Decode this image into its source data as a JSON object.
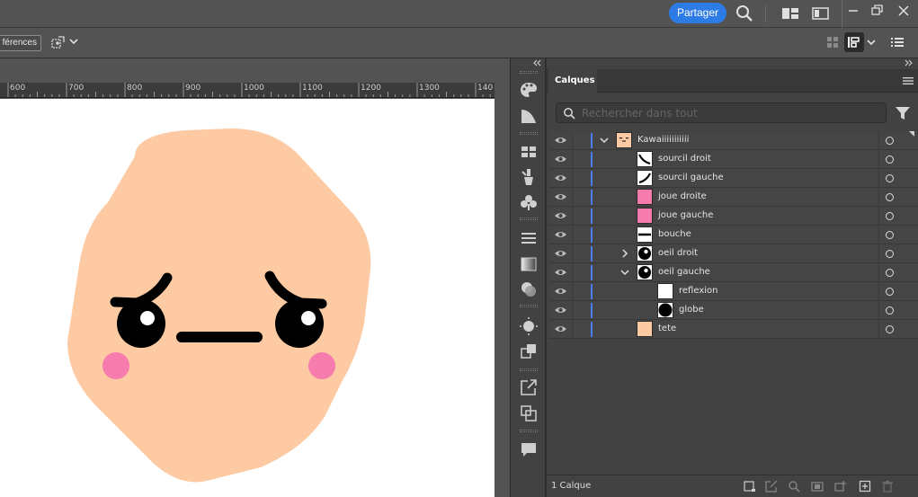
{
  "appbar": {
    "share_label": "Partager",
    "icons": [
      "search-icon",
      "arrange-documents-icon",
      "workspace-icon",
      "minimize-icon",
      "restore-icon",
      "close-icon"
    ]
  },
  "controlbar": {
    "preferences_label": "férences",
    "icons": [
      "transform-again-icon",
      "chevron-down-icon",
      "grid-icon",
      "align-panel-icon",
      "chevron-down-icon",
      "list-icon"
    ]
  },
  "ruler": {
    "ticks": [
      "600",
      "700",
      "800",
      "900",
      "1000",
      "1100",
      "1200",
      "1300",
      "140"
    ]
  },
  "strip": {
    "icons": [
      "color-icon",
      "color-guide-icon",
      "swatches-icon",
      "brushes-icon",
      "symbols-icon",
      "stroke-icon",
      "gradient-icon",
      "transparency-icon",
      "appearance-icon",
      "graphic-styles-icon",
      "export-icon",
      "artboards-icon",
      "comments-icon"
    ]
  },
  "layers_panel": {
    "tab_label": "Calques",
    "search_placeholder": "Rechercher dans tout",
    "footer_count": "1 Calque",
    "footer_icons": [
      "collect-export-icon",
      "export-selection-icon",
      "locate-object-icon",
      "make-clipping-mask-icon",
      "new-sublayer-icon",
      "new-layer-icon",
      "delete-icon"
    ],
    "layers": [
      {
        "name": "Kawaiiiiiiiiiii",
        "toggle": "open",
        "thumb": "face"
      },
      {
        "name": "sourcil droit",
        "toggle": "",
        "thumb": "brow-right"
      },
      {
        "name": "sourcil gauche",
        "toggle": "",
        "thumb": "brow-left"
      },
      {
        "name": "joue droite",
        "toggle": "",
        "thumb": "cheek"
      },
      {
        "name": "joue gauche",
        "toggle": "",
        "thumb": "cheek"
      },
      {
        "name": "bouche",
        "toggle": "",
        "thumb": "mouth"
      },
      {
        "name": "oeil droit",
        "toggle": "closed",
        "thumb": "eye"
      },
      {
        "name": "oeil gauche",
        "toggle": "open",
        "thumb": "eye"
      },
      {
        "name": "reflexion",
        "toggle": "",
        "thumb": "blank"
      },
      {
        "name": "globe",
        "toggle": "",
        "thumb": "globe"
      },
      {
        "name": "tete",
        "toggle": "",
        "thumb": "head"
      }
    ]
  },
  "colors": {
    "accent": "#2d7be5",
    "layer_bar": "#4a7df0",
    "skin": "#fdcaa3",
    "cheek": "#f57cac",
    "ink": "#000000"
  }
}
